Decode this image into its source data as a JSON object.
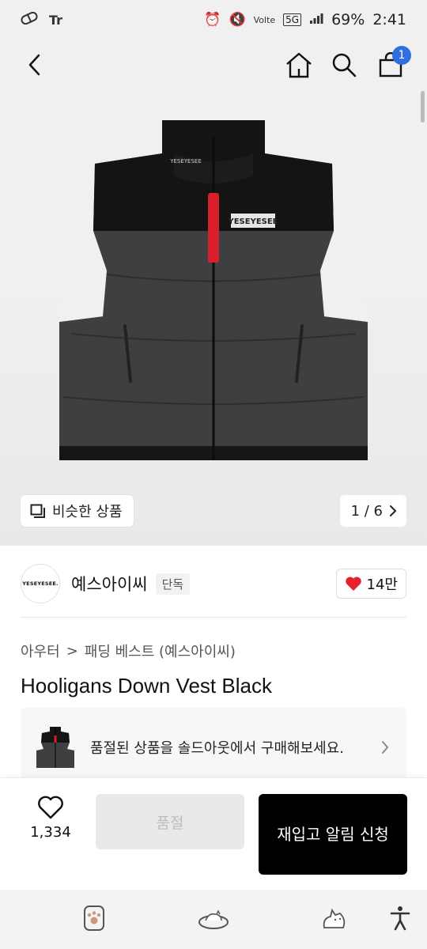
{
  "status_bar": {
    "battery": "69%",
    "time": "2:41",
    "network": "5G",
    "carrier_tag": "Volte"
  },
  "hero": {
    "similar_label": "비슷한 상품",
    "pager": "1 / 6",
    "cart_count": "1",
    "vest_brand_text": "YESEYESEE"
  },
  "brand": {
    "logo_text": "YESEYESEE.",
    "name": "예스아이씨",
    "badge": "단독",
    "likes": "14만"
  },
  "breadcrumb": {
    "category": "아우터",
    "separator": ">",
    "subcategory": "패딩 베스트 (예스아이씨)"
  },
  "product": {
    "title": "Hooligans Down Vest Black"
  },
  "soldout_banner": {
    "text": "품절된 상품을 솔드아웃에서 구매해보세요."
  },
  "actions": {
    "wish_count": "1,334",
    "soldout_label": "품절",
    "restock_label": "재입고 알림 신청"
  },
  "colors": {
    "accent_blue": "#2f6fe0",
    "heart_red": "#e5232f",
    "primary_black": "#000000"
  }
}
